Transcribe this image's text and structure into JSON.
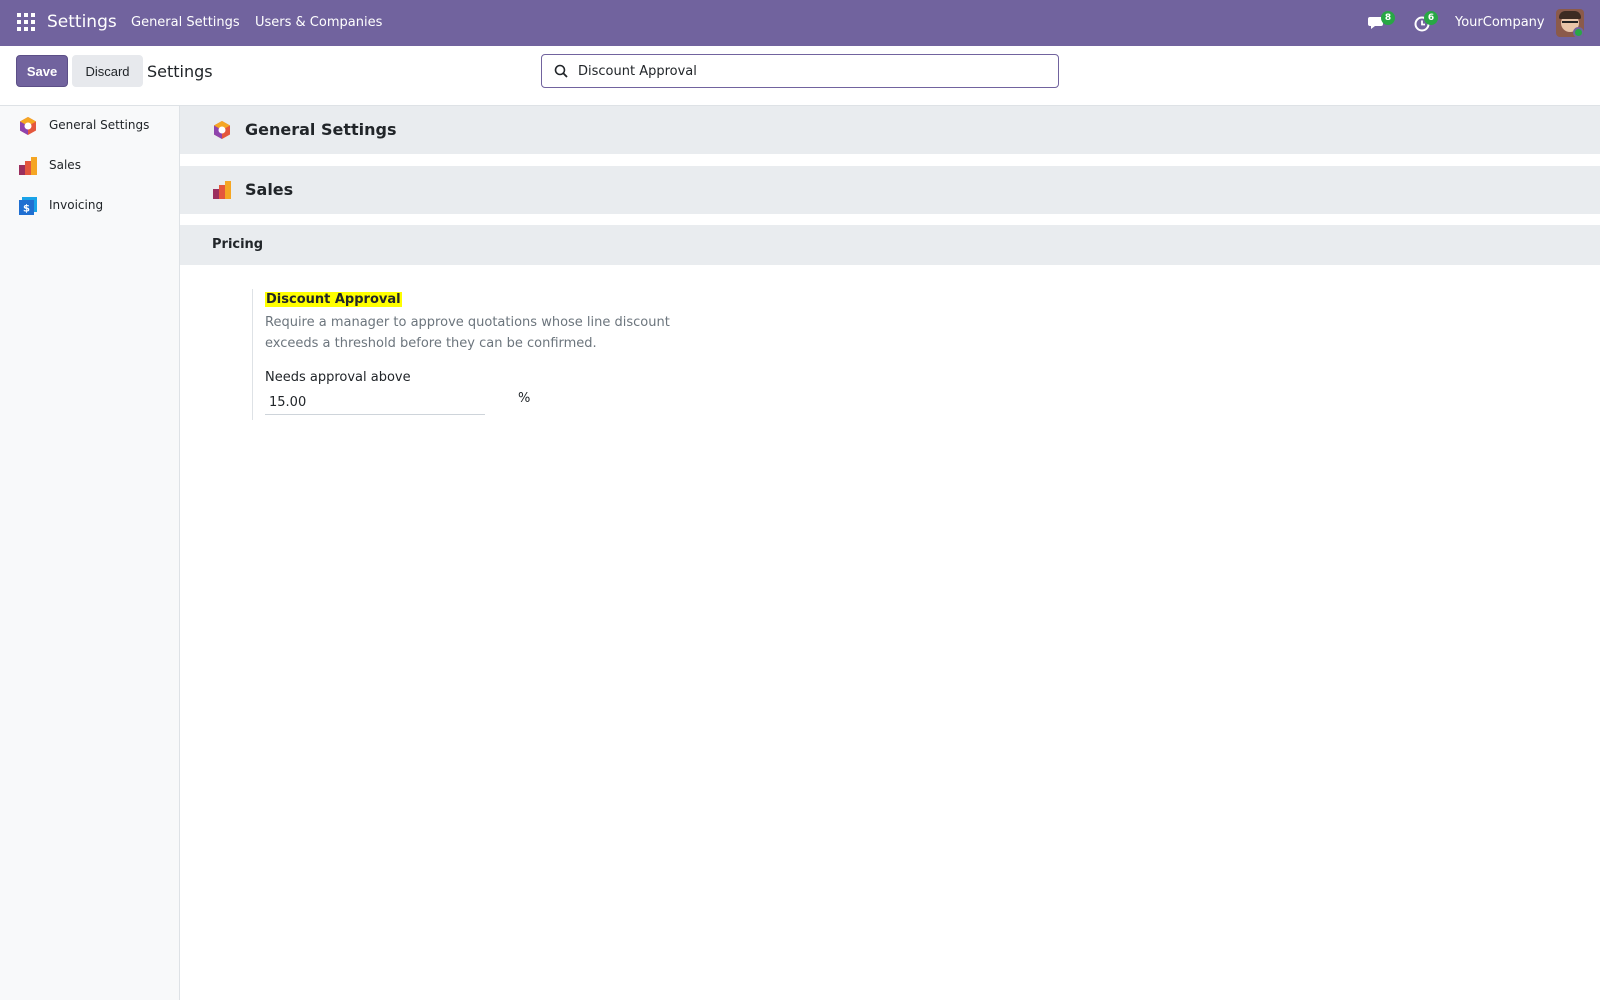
{
  "navbar": {
    "app_name": "Settings",
    "menu": [
      "General Settings",
      "Users & Companies"
    ],
    "messages_count": "8",
    "activities_count": "6",
    "company": "YourCompany",
    "color": "#71639e"
  },
  "control_panel": {
    "save_label": "Save",
    "discard_label": "Discard",
    "title": "Settings",
    "search_value": "Discount Approval"
  },
  "sidebar": {
    "items": [
      {
        "label": "General Settings",
        "icon": "general-settings-icon"
      },
      {
        "label": "Sales",
        "icon": "sales-icon"
      },
      {
        "label": "Invoicing",
        "icon": "invoicing-icon"
      }
    ]
  },
  "main": {
    "apps": [
      {
        "title": "General Settings",
        "icon": "general-settings-icon"
      },
      {
        "title": "Sales",
        "icon": "sales-icon"
      }
    ],
    "section": "Pricing",
    "setting": {
      "title": "Discount Approval",
      "description": "Require a manager to approve quotations whose line discount exceeds a threshold before they can be confirmed.",
      "field_label": "Needs approval above",
      "field_value": "15.00",
      "field_unit": "%"
    }
  }
}
